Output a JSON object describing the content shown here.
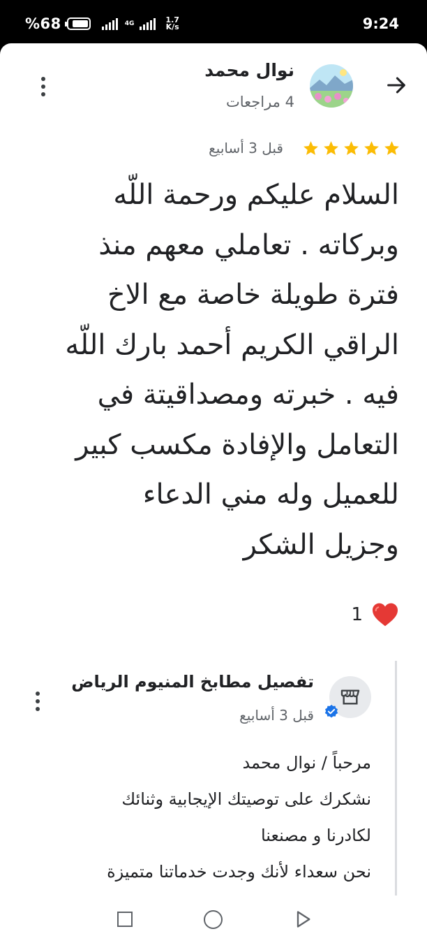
{
  "status_bar": {
    "battery_percent": "%68",
    "network_type": "4G",
    "speed_value": "1.7",
    "speed_unit": "K/s",
    "time": "9:24"
  },
  "review": {
    "reviewer_name": "نوال محمد",
    "review_count": "4 مراجعات",
    "rating": 5,
    "time_ago": "قبل 3 أسابيع",
    "text_lines": [
      "السلام عليكم ورحمة اللّه",
      "وبركاته . تعاملي معهم منذ",
      "فترة طويلة خاصة مع الاخ",
      "الراقي الكريم أحمد بارك اللّه",
      "فيه . خبرته ومصداقيتة في",
      "التعامل والإفادة مكسب كبير",
      "للعميل وله مني الدعاء",
      "وجزيل الشكر"
    ],
    "reaction_count": "1"
  },
  "owner_reply": {
    "business_name": "تفصيل مطابخ المنيوم الرياض",
    "time_ago": "قبل 3 أسابيع",
    "text_lines": [
      "مرحباً / نوال محمد",
      "نشكرك على توصيتك الإيجابية وثنائك",
      "لكادرنا و مصنعنا",
      "نحن سعداء لأنك وجدت خدماتنا متميزة"
    ]
  },
  "colors": {
    "star": "#fbbc04",
    "heart": "#e53935",
    "verified": "#1a73e8",
    "text_primary": "#202124",
    "text_secondary": "#5f6368"
  },
  "icons": {
    "back": "arrow-right-icon",
    "more": "more-vert-icon",
    "owner": "store-icon",
    "verified": "verified-badge-icon",
    "reaction": "heart-icon"
  }
}
